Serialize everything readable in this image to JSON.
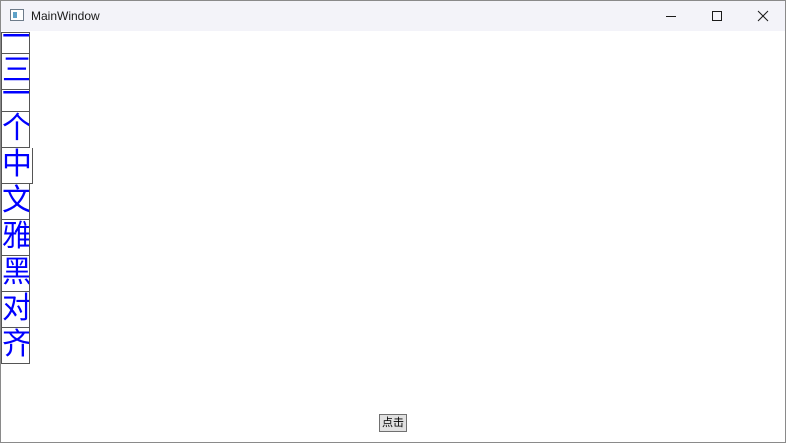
{
  "window": {
    "title": "MainWindow",
    "controls": {
      "minimize": "minimize-icon",
      "maximize": "maximize-icon",
      "close": "close-icon"
    }
  },
  "content": {
    "characters": [
      "一",
      "三",
      "一",
      "个",
      "中",
      "文",
      "雅",
      "黑",
      "对",
      "齐"
    ],
    "char_color": "#0000ff",
    "button_label": "点击"
  }
}
